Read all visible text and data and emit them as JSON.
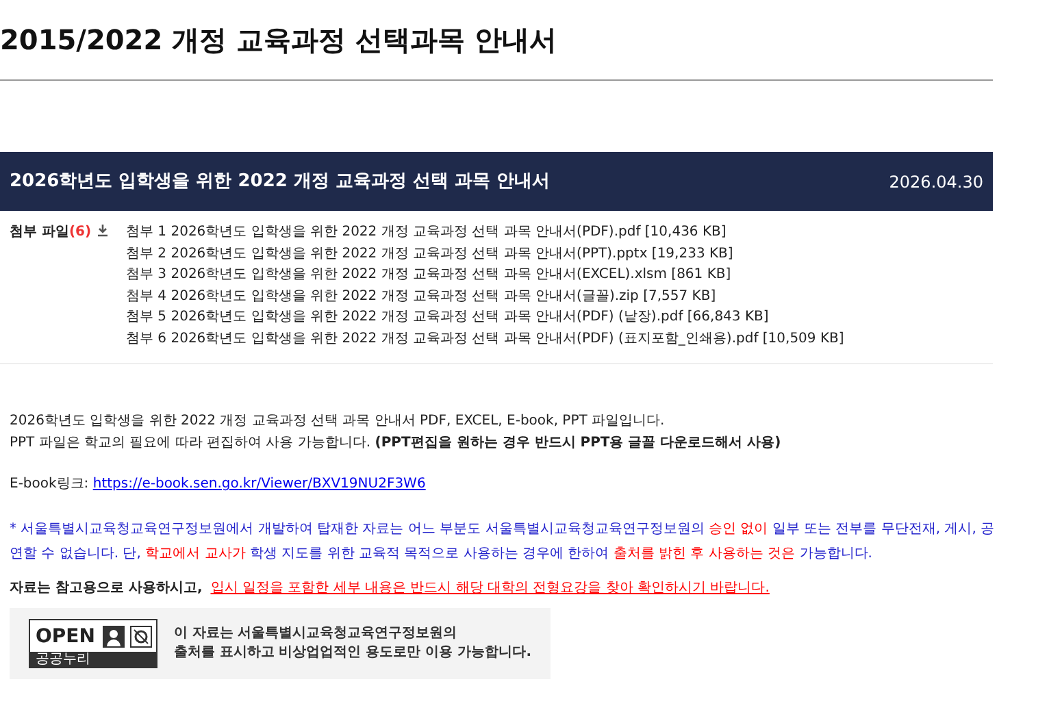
{
  "page_title": "2015/2022 개정 교육과정 선택과목 안내서",
  "post": {
    "title": "2026학년도 입학생을 위한 2022 개정 교육과정 선택 과목 안내서",
    "date": "2026.04.30"
  },
  "attachments": {
    "label": "첨부 파일",
    "count": "(6)",
    "files": [
      "첨부 1 2026학년도 입학생을 위한 2022 개정 교육과정 선택 과목 안내서(PDF).pdf [10,436 KB]",
      "첨부 2 2026학년도 입학생을 위한 2022 개정 교육과정 선택 과목 안내서(PPT).pptx [19,233 KB]",
      "첨부 3 2026학년도 입학생을 위한 2022 개정 교육과정 선택 과목 안내서(EXCEL).xlsm [861 KB]",
      "첨부 4 2026학년도 입학생을 위한 2022 개정 교육과정 선택 과목 안내서(글꼴).zip [7,557 KB]",
      "첨부 5 2026학년도 입학생을 위한 2022 개정 교육과정 선택 과목 안내서(PDF) (낱장).pdf [66,843 KB]",
      "첨부 6 2026학년도 입학생을 위한 2022 개정 교육과정 선택 과목 안내서(PDF) (표지포함_인쇄용).pdf [10,509 KB]"
    ]
  },
  "body": {
    "intro": "2026학년도 입학생을 위한 2022 개정 교육과정 선택 과목 안내서 PDF, EXCEL, E-book, PPT 파일입니다.",
    "ppt_note": "PPT 파일은 학교의 필요에 따라 편집하여 사용 가능합니다.  **(PPT편집을 원하는 경우 반드시 PPT용 글꼴 다운로드해서 사용)**",
    "ebook_label": "E-book링크: ",
    "ebook_link": "https://e-book.sen.go.kr/Viewer/BXV19NU2F3W6",
    "notice": [
      {
        "text": "* 서울특별시교육청교육연구정보원에서 개발하여 탑재한 자료는 어느 부분도 서울특별시교육청교육연구정보원의 ",
        "color": "#2222cc"
      },
      {
        "text": "승인 없이",
        "color": "#ff0000"
      },
      {
        "text": " 일부 또는 전부를 무단전재, 게시, 공연할 수 없습니다. 단, ",
        "color": "#2222cc"
      },
      {
        "text": "학교에서 교사가",
        "color": "#ff0000"
      },
      {
        "text": " 학생 지도를 위한 교육적 목적으로 사용하는 경우에 한하여 ",
        "color": "#2222cc"
      },
      {
        "text": "출처를 밝힌 후 사용하는 것은",
        "color": "#ff0000"
      },
      {
        "text": " 가능합니다.",
        "color": "#2222cc"
      }
    ],
    "closing_bold": "자료는 참고용으로 사용하시고,",
    "closing_red": "입시 일정을 포함한 세부 내용은 반드시 해당 대학의 전형요강을 찾아 확인하시기 바랍니다."
  },
  "license": {
    "logo": "OPEN",
    "logo_caption": "공공누리",
    "text_1": "이 자료는 서울특별시교육청교육연구정보원의",
    "text_2": "출처를 표시하고 비상업업적인 용도로만 이용 가능합니다."
  }
}
